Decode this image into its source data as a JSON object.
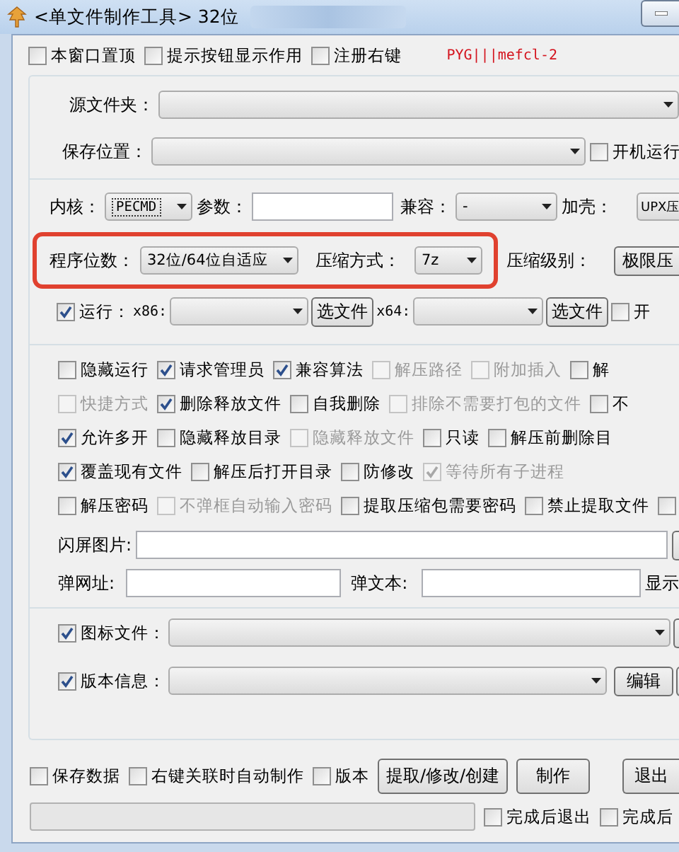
{
  "window": {
    "title": "<单文件制作工具> 32位"
  },
  "top_options": [
    {
      "label": "本窗口置顶",
      "checked": false
    },
    {
      "label": "提示按钮显示作用",
      "checked": false
    },
    {
      "label": "注册右键",
      "checked": false
    }
  ],
  "signature": "PYG|||mefcl-2",
  "source_folder": {
    "label": "源文件夹："
  },
  "save_location": {
    "label": "保存位置：",
    "option": {
      "label": "开机运行",
      "checked": false
    }
  },
  "kernel": {
    "label": "内核：",
    "value": "PECMD",
    "params_label": "参数：",
    "compat_label": "兼容：",
    "compat_value": "-",
    "packer_label": "加壳：",
    "packer_value": "UPX压"
  },
  "program_bits": {
    "label": "程序位数：",
    "value": "32位/64位自适应",
    "compression_label": "压缩方式：",
    "compression_value": "7z",
    "level_label": "压缩级别：",
    "level_value": "极限压"
  },
  "run": {
    "label": "运行：",
    "checked": true,
    "x86_label": "x86:",
    "x86_button": "选文件",
    "x64_label": "x64:",
    "x64_button": "选文件",
    "option": {
      "label": "开",
      "checked": false
    }
  },
  "options": [
    [
      {
        "label": "隐藏运行",
        "checked": false,
        "disabled": false
      },
      {
        "label": "请求管理员",
        "checked": true,
        "disabled": false
      },
      {
        "label": "兼容算法",
        "checked": true,
        "disabled": false
      },
      {
        "label": "解压路径",
        "checked": false,
        "disabled": true
      },
      {
        "label": "附加插入",
        "checked": false,
        "disabled": true
      },
      {
        "label": "解",
        "checked": false,
        "disabled": false
      }
    ],
    [
      {
        "label": "快捷方式",
        "checked": false,
        "disabled": true
      },
      {
        "label": "删除释放文件",
        "checked": true,
        "disabled": false
      },
      {
        "label": "自我删除",
        "checked": false,
        "disabled": false
      },
      {
        "label": "排除不需要打包的文件",
        "checked": false,
        "disabled": true
      },
      {
        "label": "不",
        "checked": false,
        "disabled": false
      }
    ],
    [
      {
        "label": "允许多开",
        "checked": true,
        "disabled": false
      },
      {
        "label": "隐藏释放目录",
        "checked": false,
        "disabled": false
      },
      {
        "label": "隐藏释放文件",
        "checked": false,
        "disabled": true
      },
      {
        "label": "只读",
        "checked": false,
        "disabled": false
      },
      {
        "label": "解压前删除目",
        "checked": false,
        "disabled": false
      }
    ],
    [
      {
        "label": "覆盖现有文件",
        "checked": true,
        "disabled": false
      },
      {
        "label": "解压后打开目录",
        "checked": false,
        "disabled": false
      },
      {
        "label": "防修改",
        "checked": false,
        "disabled": false
      },
      {
        "label": "等待所有子进程",
        "checked": true,
        "disabled": true
      }
    ],
    [
      {
        "label": "解压密码",
        "checked": false,
        "disabled": false
      },
      {
        "label": "不弹框自动输入密码",
        "checked": false,
        "disabled": true
      },
      {
        "label": "提取压缩包需要密码",
        "checked": false,
        "disabled": false
      },
      {
        "label": "禁止提取文件",
        "checked": false,
        "disabled": false
      },
      {
        "checked": false,
        "disabled": false
      }
    ]
  ],
  "splash": {
    "label": "闪屏图片:"
  },
  "popup": {
    "url_label": "弹网址:",
    "text_label": "弹文本:",
    "show_label": "显示"
  },
  "icon_file": {
    "label": "图标文件：",
    "checked": true
  },
  "version_info": {
    "label": "版本信息：",
    "checked": true,
    "edit_button": "编辑"
  },
  "bottom_options": [
    {
      "label": "保存数据",
      "checked": false
    },
    {
      "label": "右键关联时自动制作",
      "checked": false
    },
    {
      "label": "版本",
      "checked": false
    }
  ],
  "buttons": [
    "提取/修改/创建",
    "制作",
    "退出"
  ],
  "progress": {
    "level": 0
  },
  "finish_options": [
    {
      "label": "完成后退出",
      "checked": false
    },
    {
      "label": "完成后",
      "checked": false
    }
  ]
}
